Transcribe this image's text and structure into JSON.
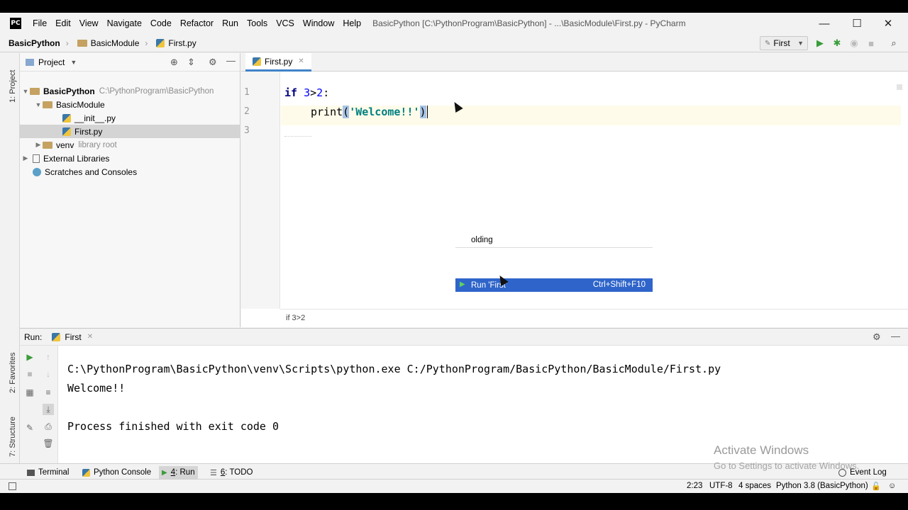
{
  "app": {
    "logo": "PC",
    "menu": [
      "File",
      "Edit",
      "View",
      "Navigate",
      "Code",
      "Refactor",
      "Run",
      "Tools",
      "VCS",
      "Window",
      "Help"
    ],
    "window_title": "BasicPython [C:\\PythonProgram\\BasicPython] - ...\\BasicModule\\First.py - PyCharm",
    "window_controls": {
      "minimize": "—",
      "maximize": "☐",
      "close": "✕"
    }
  },
  "nav": {
    "crumbs": [
      "BasicPython",
      "BasicModule",
      "First.py"
    ],
    "run_config": "First"
  },
  "left_strip": {
    "project": "1: Project",
    "favorites": "2: Favorites",
    "structure": "7: Structure"
  },
  "project": {
    "header": "Project",
    "tree": [
      {
        "label": "BasicPython",
        "hint": "C:\\PythonProgram\\BasicPython"
      },
      {
        "label": "BasicModule",
        "hint": ""
      },
      {
        "label": "__init__.py",
        "hint": ""
      },
      {
        "label": "First.py",
        "hint": ""
      },
      {
        "label": "venv",
        "hint": "library root"
      },
      {
        "label": "External Libraries",
        "hint": ""
      },
      {
        "label": "Scratches and Consoles",
        "hint": ""
      }
    ]
  },
  "editor": {
    "tab": "First.py",
    "line_numbers": [
      "1",
      "2",
      "3"
    ],
    "code": {
      "l1_kw": "if",
      "l1_num1": "3",
      "l1_op": ">",
      "l1_num2": "2",
      "l1_colon": ":",
      "l2_fn": "print",
      "l2_open": "(",
      "l2_str": "'Welcome!!'",
      "l2_close": ")"
    },
    "breadcrumb": "if 3>2"
  },
  "context_menu": {
    "folding": "olding",
    "run_item": "Run 'First'",
    "run_shortcut": "Ctrl+Shift+F10"
  },
  "run": {
    "label": "Run:",
    "config": "First",
    "output": [
      "C:\\PythonProgram\\BasicPython\\venv\\Scripts\\python.exe C:/PythonProgram/BasicPython/BasicModule/First.py",
      "Welcome!!",
      "",
      "Process finished with exit code 0"
    ]
  },
  "bottom_tabs": {
    "terminal": "Terminal",
    "python_console": "Python Console",
    "run_num": "4",
    "run_label": ": Run",
    "todo_num": "6",
    "todo_label": ": TODO",
    "event_log": "Event Log"
  },
  "status": {
    "position": "2:23",
    "encoding": "UTF-8",
    "indent": "4 spaces",
    "interpreter": "Python 3.8 (BasicPython)"
  },
  "watermark": {
    "line1": "Activate Windows",
    "line2": "Go to Settings to activate Windows."
  }
}
